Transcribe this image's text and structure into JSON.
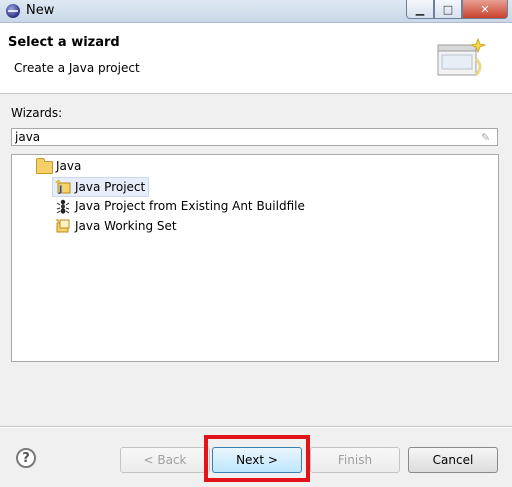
{
  "window": {
    "title": "New"
  },
  "header": {
    "title": "Select a wizard",
    "subtitle": "Create a Java project"
  },
  "wizards": {
    "label": "Wizards:",
    "filter_value": "java",
    "tree": {
      "folder": {
        "label": "Java",
        "icon": "folder-open-icon"
      },
      "items": [
        {
          "label": "Java Project",
          "icon": "java-project-icon",
          "selected": true
        },
        {
          "label": "Java Project from Existing Ant Buildfile",
          "icon": "ant-icon",
          "selected": false
        },
        {
          "label": "Java Working Set",
          "icon": "working-set-icon",
          "selected": false
        }
      ]
    }
  },
  "buttons": {
    "back": "< Back",
    "next": "Next >",
    "finish": "Finish",
    "cancel": "Cancel",
    "help": "?"
  },
  "colors": {
    "highlight": "#e2141b",
    "selection": "#e7eef9"
  }
}
